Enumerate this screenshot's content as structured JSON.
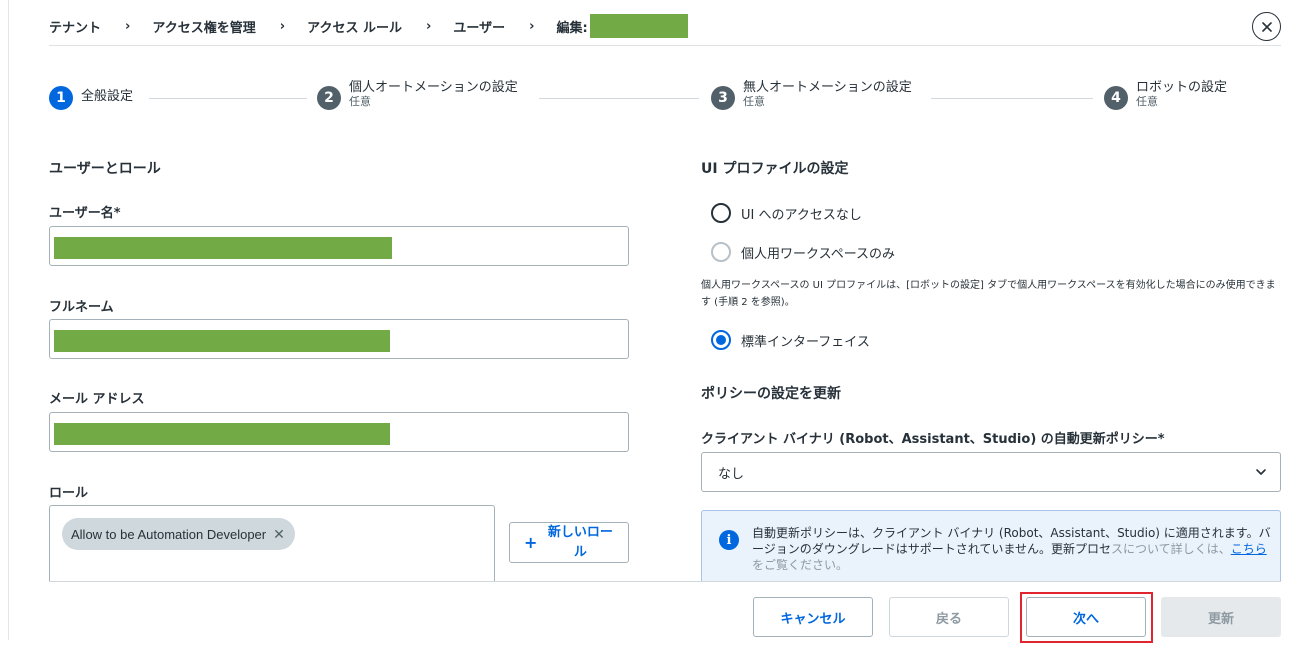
{
  "breadcrumb": {
    "items": [
      "テナント",
      "アクセス権を管理",
      "アクセス ルール",
      "ユーザー"
    ],
    "current": "編集:"
  },
  "stepper": {
    "steps": [
      {
        "number": "1",
        "label": "全般設定",
        "sub": "",
        "active": true
      },
      {
        "number": "2",
        "label": "個人オートメーションの設定",
        "sub": "任意",
        "active": false
      },
      {
        "number": "3",
        "label": "無人オートメーションの設定",
        "sub": "任意",
        "active": false
      },
      {
        "number": "4",
        "label": "ロボットの設定",
        "sub": "任意",
        "active": false
      }
    ]
  },
  "users_roles": {
    "title": "ユーザーとロール",
    "username_label": "ユーザー名*",
    "fullname_label": "フルネーム",
    "email_label": "メール アドレス",
    "roles_label": "ロール",
    "role_chip": "Allow to be Automation Developer",
    "new_role_button": "新しいロール"
  },
  "ui_profile": {
    "title": "UI プロファイルの設定",
    "options": [
      {
        "label": "UI へのアクセスなし",
        "state": "unchecked"
      },
      {
        "label": "個人用ワークスペースのみ",
        "state": "disabled"
      },
      {
        "label": "標準インターフェイス",
        "state": "checked"
      }
    ],
    "note": "個人用ワークスペースの UI プロファイルは、[ロボットの設定] タブで個人用ワークスペースを有効化した場合にのみ使用できます (手順 2 を参照)。"
  },
  "update_policy": {
    "title": "ポリシーの設定を更新",
    "field_label": "クライアント バイナリ (Robot、Assistant、Studio) の自動更新ポリシー*",
    "selected": "なし",
    "info_main": "自動更新ポリシーは、クライアント バイナリ (Robot、Assistant、Studio) に適用されます。バージョンのダウングレードはサポートされていません。更新プロセ",
    "info_faded_prefix": "スについて詳しくは、",
    "info_link": "こちら",
    "info_faded_suffix": "をご覧ください。"
  },
  "footer": {
    "cancel": "キャンセル",
    "back": "戻る",
    "next": "次へ",
    "update": "更新"
  },
  "colors": {
    "accent": "#0067df",
    "redaction": "#72ab46",
    "highlight": "#e0252e"
  }
}
